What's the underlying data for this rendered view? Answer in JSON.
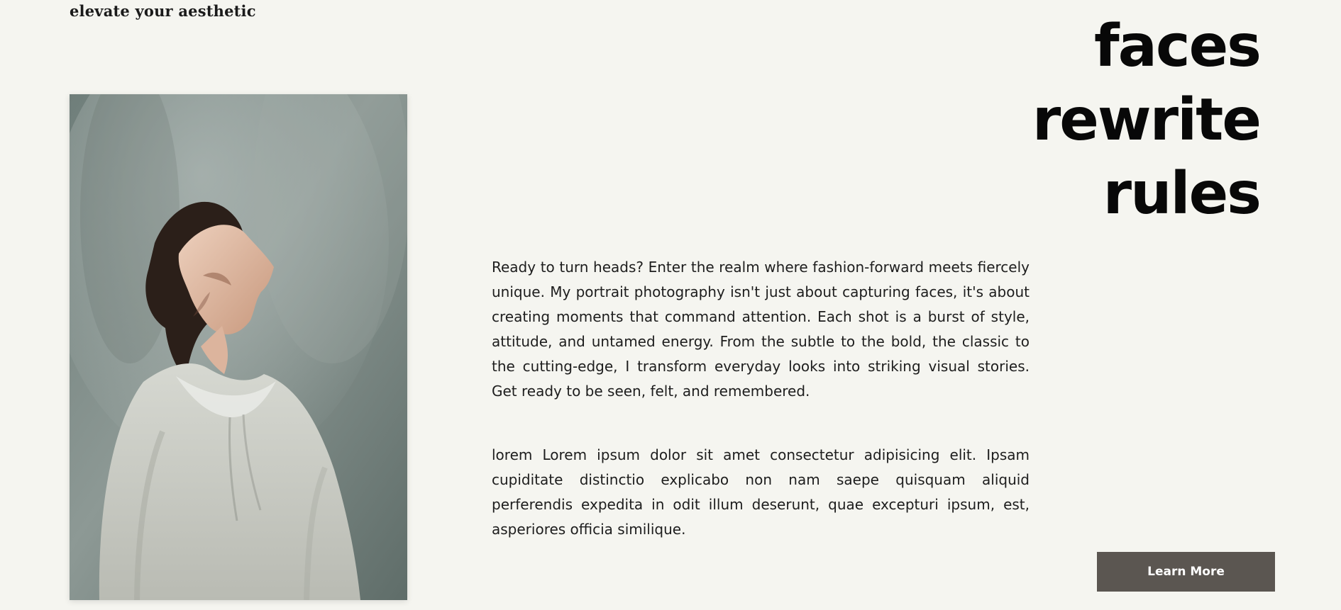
{
  "tagline": "elevate your aesthetic",
  "headline": {
    "line1": "faces",
    "line2": "rewrite",
    "line3": "rules"
  },
  "intro": "Ready to turn heads? Enter the realm where fashion-forward meets fiercely unique. My portrait photography isn't just about capturing faces, it's about creating moments that command attention. Each shot is a burst of style, attitude, and untamed energy. From the subtle to the bold, the classic to the cutting-edge, I transform everyday looks into striking visual stories. Get ready to be seen, felt, and remembered.",
  "secondary": "lorem Lorem ipsum dolor sit amet consectetur adipisicing elit. Ipsam cupiditate distinctio explicabo non nam saepe quisquam aliquid perferendis expedita in odit illum deserunt, quae excepturi ipsum, est, asperiores officia similique.",
  "cta": {
    "label": "Learn More"
  },
  "colors": {
    "page_background": "#f5f5f0",
    "button_background": "#5b5651",
    "button_text": "#ffffff",
    "headline": "#080808"
  }
}
